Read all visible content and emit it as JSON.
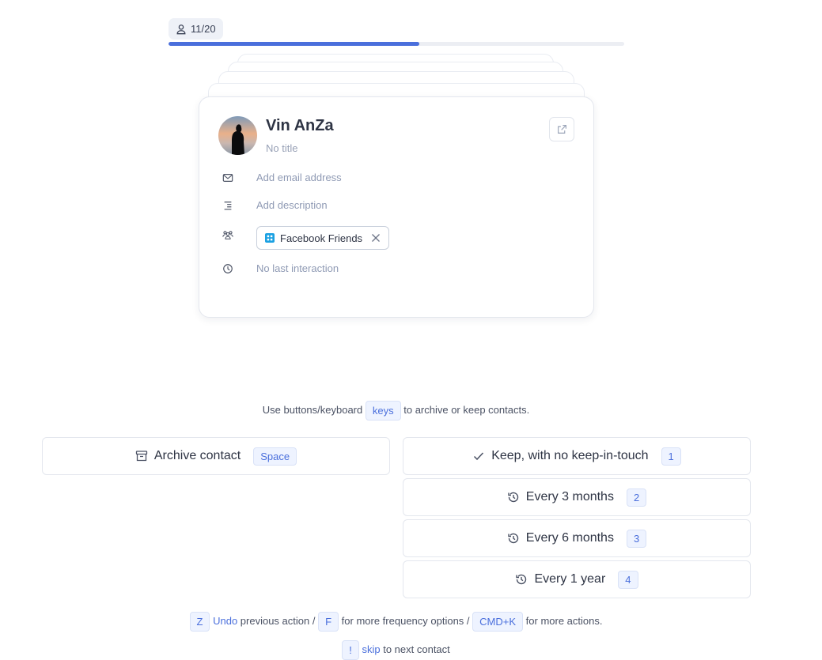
{
  "progress": {
    "label": "11/20",
    "fraction": 0.55
  },
  "contact": {
    "name": "Vin AnZa",
    "title": "No title",
    "email_placeholder": "Add email address",
    "description_placeholder": "Add description",
    "tag": "Facebook Friends",
    "last_interaction": "No last interaction"
  },
  "hint": {
    "before": "Use buttons/keyboard",
    "key": "keys",
    "after": "to archive or keep contacts."
  },
  "actions": {
    "archive": {
      "label": "Archive contact",
      "key": "Space"
    },
    "keep": {
      "label": "Keep, with no keep-in-touch",
      "key": "1"
    },
    "three_months": {
      "label": "Every 3 months",
      "key": "2"
    },
    "six_months": {
      "label": "Every 6 months",
      "key": "3"
    },
    "one_year": {
      "label": "Every 1 year",
      "key": "4"
    }
  },
  "footer": {
    "undo_key": "Z",
    "undo_label": "Undo",
    "undo_rest": "previous action /",
    "freq_key": "F",
    "freq_rest": "for more frequency options /",
    "cmd_key": "CMD+K",
    "cmd_rest": "for more actions.",
    "skip_key": "!",
    "skip_label": "skip",
    "skip_rest": "to next contact"
  },
  "colors": {
    "accent": "#4a6fdc",
    "tag_icon": "#1ba1e2"
  }
}
